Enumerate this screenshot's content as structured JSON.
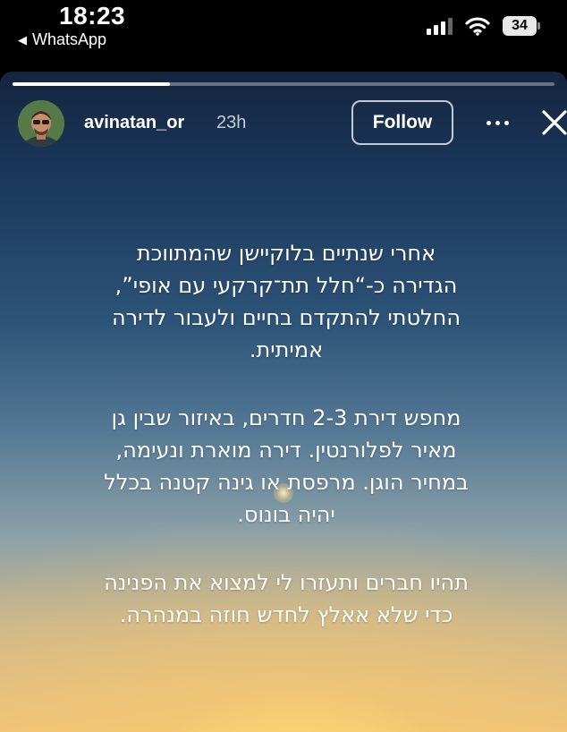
{
  "status_bar": {
    "time": "18:23",
    "back_app_label": "WhatsApp",
    "battery_level": "34",
    "signal_bars": 3
  },
  "story": {
    "progress": 0.29,
    "header": {
      "username": "avinatan_or",
      "time_ago": "23h",
      "follow_label": "Follow"
    },
    "paragraphs": [
      {
        "lines": [
          "אחרי שנתיים בלוקיישן שהמתווכת",
          "הגדירה כ-“חלל תת־קרקעי עם אופי”,",
          "החלטתי להתקדם בחיים ולעבור לדירה",
          "אמיתית."
        ]
      },
      {
        "lines": [
          "מחפש דירת 2-3 חדרים, באיזור שבין גן",
          "מאיר לפלורנטין. דירה מוארת ונעימה,",
          "במחיר הוגן. מרפסת או גינה קטנה בכלל",
          "יהיה בונוס."
        ]
      },
      {
        "lines": [
          "תהיו חברים ותעזרו לי למצוא את הפנינה",
          "כדי שלא אאלץ לחדש חוזה במנהרה."
        ]
      }
    ]
  },
  "colors": {
    "sky_top": "#14253f",
    "sunset": "#edc27e",
    "text": "#ffffff"
  },
  "icons": [
    "back-arrow-icon",
    "signal-icon",
    "wifi-icon",
    "battery-icon",
    "more-icon",
    "close-icon"
  ]
}
